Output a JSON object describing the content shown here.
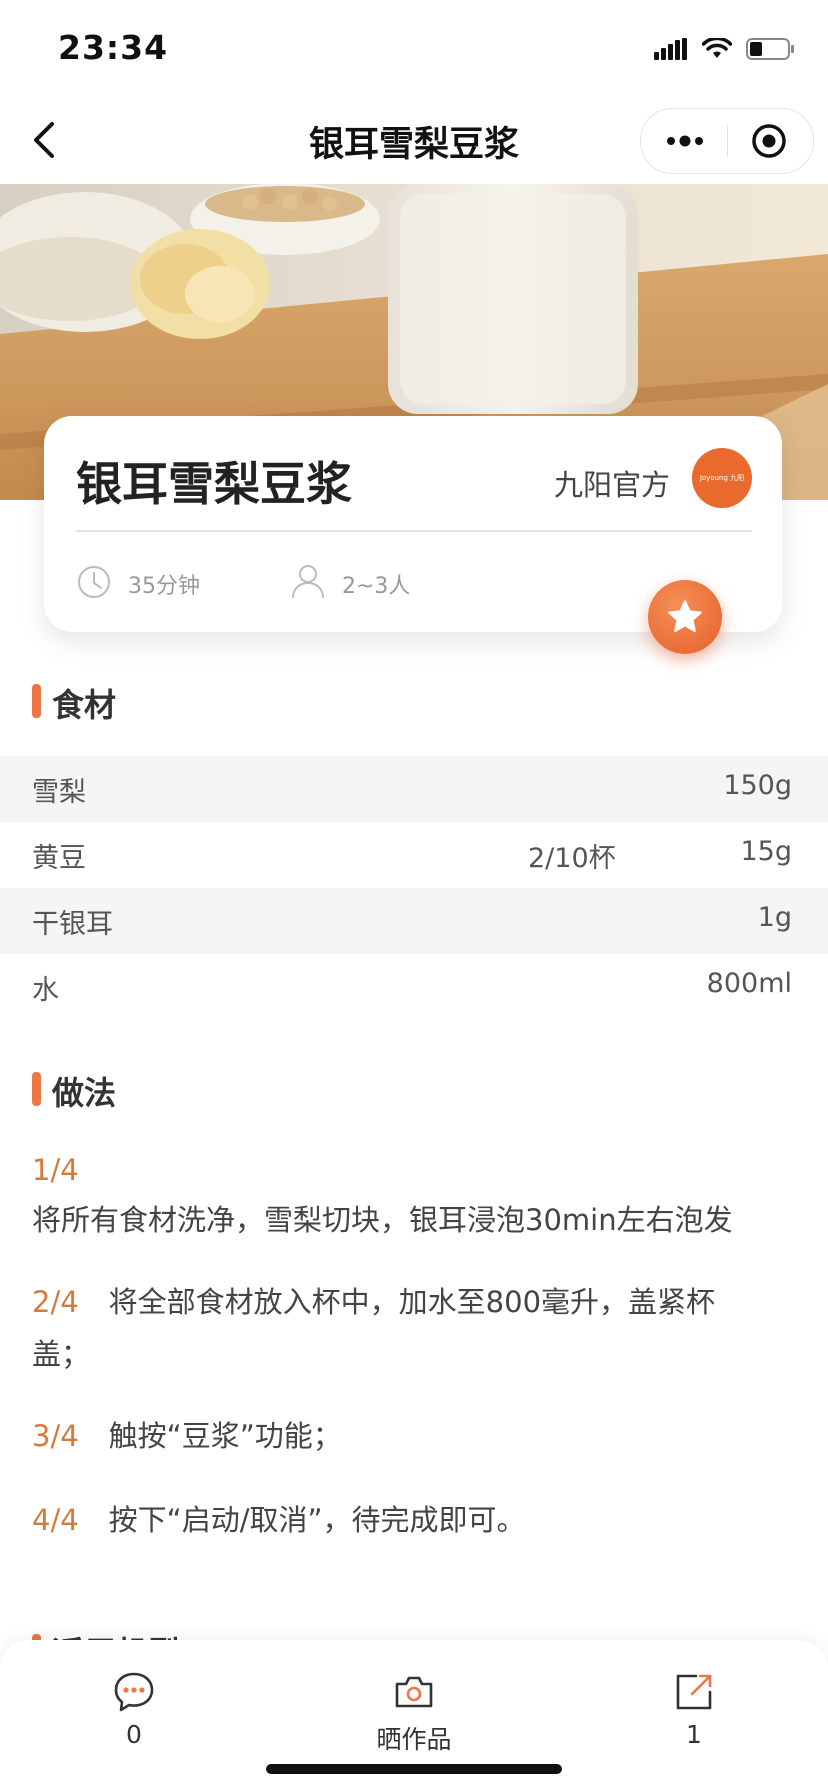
{
  "status_bar": {
    "time": "23:34"
  },
  "nav": {
    "title": "银耳雪梨豆浆"
  },
  "card": {
    "title": "银耳雪梨豆浆",
    "author": "九阳官方",
    "avatar_text": "Joyoung 九阳",
    "duration": "35分钟",
    "servings": "2~3人"
  },
  "ingredients": {
    "heading": "食材",
    "rows": [
      {
        "name": "雪梨",
        "cup": "",
        "amount": "150g"
      },
      {
        "name": "黄豆",
        "cup": "2/10杯",
        "amount": "15g"
      },
      {
        "name": "干银耳",
        "cup": "",
        "amount": "1g"
      },
      {
        "name": "水",
        "cup": "",
        "amount": "800ml"
      }
    ]
  },
  "method": {
    "heading": "做法",
    "steps": [
      {
        "no": "1/4",
        "text": "将所有食材洗净，雪梨切块，银耳浸泡30min左右泡发"
      },
      {
        "no": "2/4",
        "text": "将全部食材放入杯中，加水至800毫升，盖紧杯盖；"
      },
      {
        "no": "3/4",
        "text": "触按“豆浆”功能；"
      },
      {
        "no": "4/4",
        "text": "按下“启动/取消”，待完成即可。"
      }
    ]
  },
  "next_section": {
    "heading": "适用机型"
  },
  "bottom_bar": {
    "comments_count": "0",
    "post_label": "晒作品",
    "share_count": "1"
  },
  "colors": {
    "accent": "#ee7545",
    "step_number": "#d47a3a",
    "avatar": "#ea6a2d"
  }
}
